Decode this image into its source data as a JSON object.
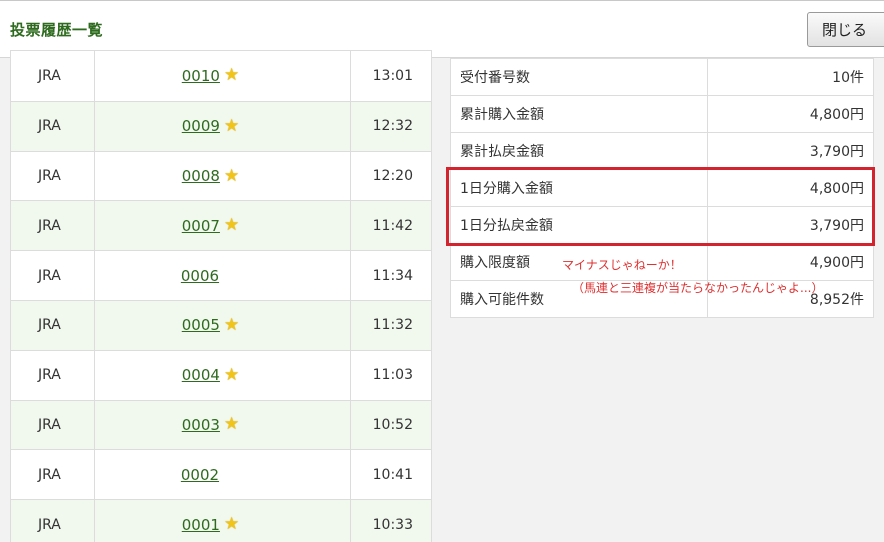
{
  "header": {
    "title": "投票履歴一覧",
    "close_label": "閉じる"
  },
  "history": [
    {
      "org": "JRA",
      "number": "0010",
      "star": true,
      "time": "13:01"
    },
    {
      "org": "JRA",
      "number": "0009",
      "star": true,
      "time": "12:32"
    },
    {
      "org": "JRA",
      "number": "0008",
      "star": true,
      "time": "12:20"
    },
    {
      "org": "JRA",
      "number": "0007",
      "star": true,
      "time": "11:42"
    },
    {
      "org": "JRA",
      "number": "0006",
      "star": false,
      "time": "11:34"
    },
    {
      "org": "JRA",
      "number": "0005",
      "star": true,
      "time": "11:32"
    },
    {
      "org": "JRA",
      "number": "0004",
      "star": true,
      "time": "11:03"
    },
    {
      "org": "JRA",
      "number": "0003",
      "star": true,
      "time": "10:52"
    },
    {
      "org": "JRA",
      "number": "0002",
      "star": false,
      "time": "10:41"
    },
    {
      "org": "JRA",
      "number": "0001",
      "star": true,
      "time": "10:33"
    }
  ],
  "summary": [
    {
      "label": "受付番号数",
      "value": "10件"
    },
    {
      "label": "累計購入金額",
      "value": "4,800円"
    },
    {
      "label": "累計払戻金額",
      "value": "3,790円"
    },
    {
      "label": "1日分購入金額",
      "value": "4,800円"
    },
    {
      "label": "1日分払戻金額",
      "value": "3,790円"
    },
    {
      "label": "購入限度額",
      "value": "4,900円"
    },
    {
      "label": "購入可能件数",
      "value": "8,952件"
    }
  ],
  "annotation": {
    "line1": "マイナスじゃねーか！",
    "line2": "（馬連と三連複が当たらなかったんじゃよ...）"
  },
  "colors": {
    "accent_green": "#2e6b1f",
    "highlight_red": "#d3232f",
    "star": "#f0c419"
  }
}
